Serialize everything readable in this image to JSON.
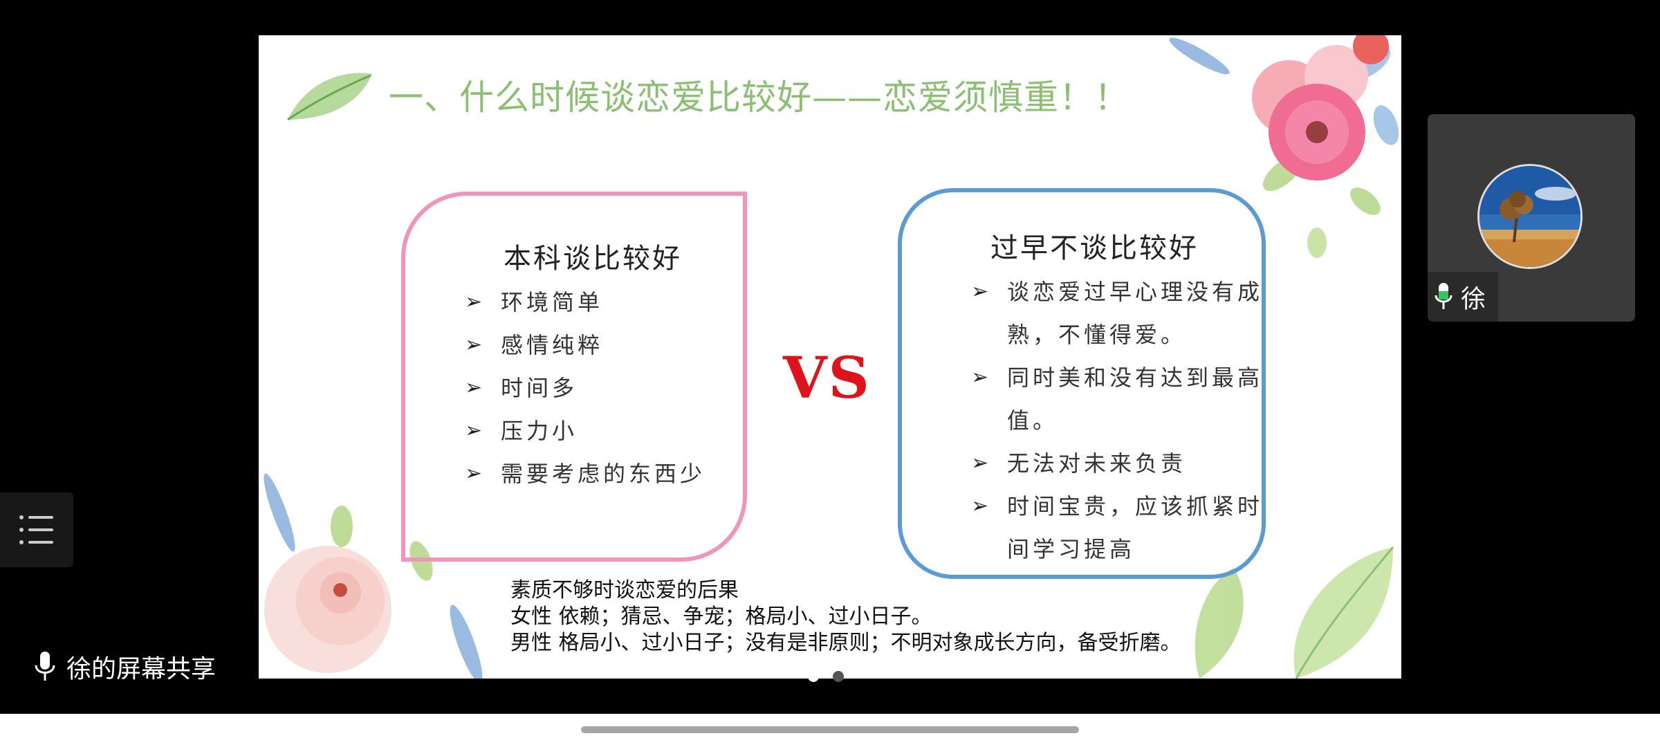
{
  "slide": {
    "title": "一、什么时候谈恋爱比较好——恋爱须慎重！！",
    "left_box": {
      "title": "本科谈比较好",
      "items": [
        "环境简单",
        "感情纯粹",
        "时间多",
        "压力小",
        "需要考虑的东西少"
      ]
    },
    "vs": "VS",
    "right_box": {
      "title": "过早不谈比较好",
      "items": [
        [
          "谈恋爱过早心理没有成",
          "熟，不懂得爱。"
        ],
        [
          "同时美和没有达到最高",
          "值。"
        ],
        [
          "无法对未来负责"
        ],
        [
          "时间宝贵，应该抓紧时",
          "间学习提高"
        ]
      ]
    },
    "consequences": {
      "heading": "素质不够时谈恋爱的后果",
      "female": "女性  依赖；猜忌、争宠；格局小、过小日子。",
      "male": "男性  格局小、过小日子；没有是非原则；不明对象成长方向，备受折磨。"
    }
  },
  "participant": {
    "name": "徐",
    "mic_icon": "mic-icon",
    "mic_color": "#35c759"
  },
  "screen_share": {
    "label": "徐的屏幕共享",
    "mic_icon": "mic-icon"
  },
  "menu_icon": "list-menu-icon",
  "pages": {
    "total": 2,
    "current": 1
  },
  "colors": {
    "title_green": "#8bbf72",
    "left_border_pink": "#ef95b8",
    "right_border_blue": "#5b9bd5",
    "vs_red": "#e0121b"
  }
}
